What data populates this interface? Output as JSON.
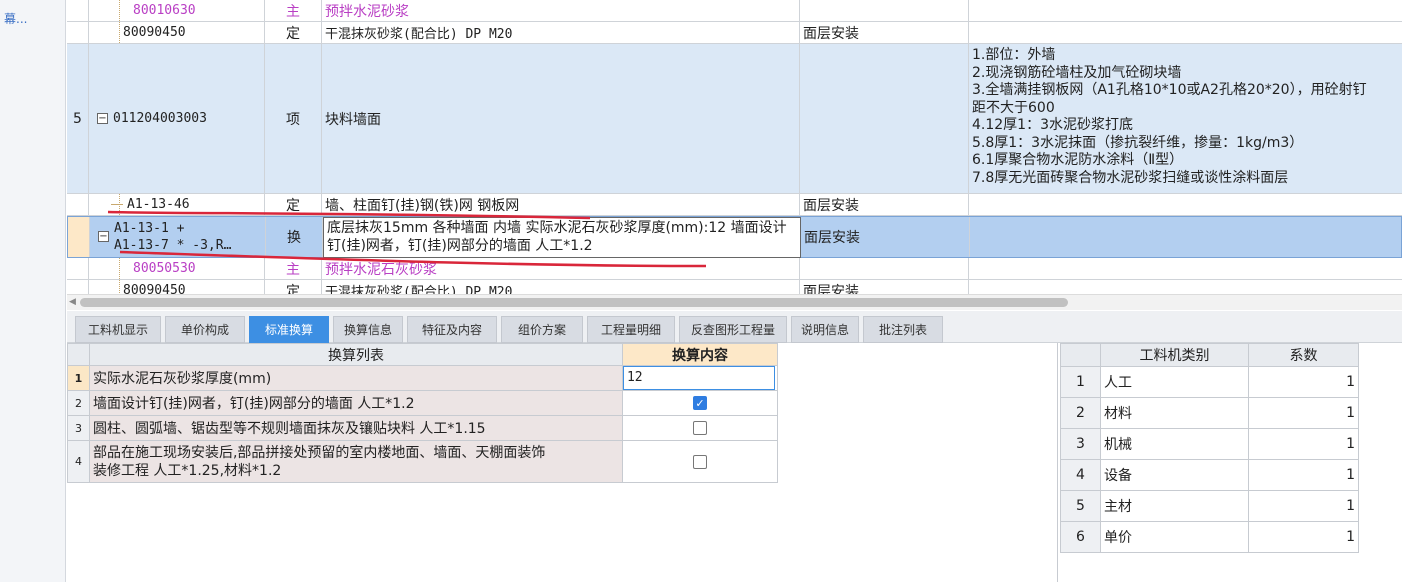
{
  "sidebar": {
    "link_text": "幕..."
  },
  "upper_rows": {
    "r0": {
      "code": "80010630",
      "type": "主",
      "name": "预拌水泥砂浆"
    },
    "r1": {
      "code": "80090450",
      "type": "定",
      "name": "干混抹灰砂浆(配合比) DP M20",
      "unit": "面层安装"
    },
    "r2": {
      "no": "5",
      "expander": "−",
      "code": "011204003003",
      "type": "项",
      "name": "块料墙面",
      "features": [
        "1.部位：外墙",
        "2.现浇钢筋砼墙柱及加气砼砌块墙",
        "3.全墙满挂钢板网（A1孔格10*10或A2孔格20*20），用砼射钉",
        "距不大于600",
        "4.12厚1：3水泥砂浆打底",
        "5.8厚1：3水泥抹面（掺抗裂纤维，掺量：1kg/m3）",
        "6.1厚聚合物水泥防水涂料（Ⅱ型）",
        "7.8厚无光面砖聚合物水泥砂浆扫缝或谈性涂料面层"
      ]
    },
    "r3": {
      "code": "A1-13-46",
      "type": "定",
      "name": "墙、柱面钉(挂)钢(铁)网 钢板网",
      "unit": "面层安装"
    },
    "r4": {
      "expander": "−",
      "code_line1": "A1-13-1 +",
      "code_line2": "A1-13-7 * -3,R…",
      "type": "换",
      "name": "底层抹灰15mm 各种墙面 内墙  实际水泥石灰砂浆厚度(mm):12  墙面设计钉(挂)网者，钉(挂)网部分的墙面 人工*1.2",
      "unit": "面层安装"
    },
    "r5": {
      "code": "80050530",
      "type": "主",
      "name": "预拌水泥石灰砂浆"
    },
    "r6": {
      "code": "80090450",
      "type": "定",
      "name": "干混抹灰砂浆(配合比) DP M20",
      "unit": "面层安装"
    }
  },
  "tabs": [
    "工料机显示",
    "单价构成",
    "标准换算",
    "换算信息",
    "特征及内容",
    "组价方案",
    "工程量明细",
    "反查图形工程量",
    "说明信息",
    "批注列表"
  ],
  "active_tab": "标准换算",
  "conversion": {
    "col1": "换算列表",
    "col2": "换算内容",
    "rows": [
      {
        "idx": "1",
        "label": "实际水泥石灰砂浆厚度(mm)",
        "value": "12"
      },
      {
        "idx": "2",
        "label": "墙面设计钉(挂)网者，钉(挂)网部分的墙面 人工*1.2",
        "checked": true
      },
      {
        "idx": "3",
        "label": "圆柱、圆弧墙、锯齿型等不规则墙面抹灰及镶贴块料 人工*1.15",
        "checked": false
      },
      {
        "idx": "4",
        "label_line1": "部品在施工现场安装后,部品拼接处预留的室内楼地面、墙面、天棚面装饰",
        "label_line2": "装修工程 人工*1.25,材料*1.2",
        "checked": false
      }
    ]
  },
  "coefficients": {
    "col1": "工料机类别",
    "col2": "系数",
    "rows": [
      {
        "idx": "1",
        "name": "人工",
        "value": "1"
      },
      {
        "idx": "2",
        "name": "材料",
        "value": "1"
      },
      {
        "idx": "3",
        "name": "机械",
        "value": "1"
      },
      {
        "idx": "4",
        "name": "设备",
        "value": "1"
      },
      {
        "idx": "5",
        "name": "主材",
        "value": "1"
      },
      {
        "idx": "6",
        "name": "单价",
        "value": "1"
      }
    ]
  },
  "colors": {
    "accent": "#3d8fe3",
    "selected_row": "#b3cff0",
    "item_row": "#dbe8f6",
    "material": "#b93fc4",
    "annotation": "#d9263a"
  }
}
